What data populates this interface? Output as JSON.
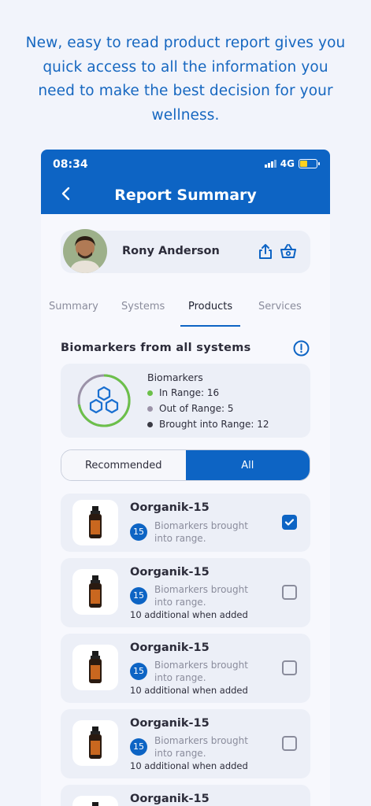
{
  "tagline": "New, easy to read product report gives you quick access to all the information you need to make the best decision for your wellness.",
  "status_bar": {
    "time": "08:34",
    "network": "4G"
  },
  "header": {
    "title": "Report Summary"
  },
  "user": {
    "name": "Rony Anderson"
  },
  "tabs": [
    {
      "label": "Summary",
      "active": false
    },
    {
      "label": "Systems",
      "active": false
    },
    {
      "label": "Products",
      "active": true
    },
    {
      "label": "Services",
      "active": false
    }
  ],
  "biomarkers": {
    "section_title": "Biomarkers from all systems",
    "card_title": "Biomarkers",
    "legend": [
      {
        "label": "In Range: 16",
        "value": 16,
        "color": "#6cc04a"
      },
      {
        "label": "Out of Range: 5",
        "value": 5,
        "color": "#9b92a8"
      },
      {
        "label": "Brought into Range: 12",
        "value": 12,
        "color": "#3a3a44"
      }
    ]
  },
  "filter": {
    "left_label": "Recommended",
    "right_label": "All",
    "selected": "All"
  },
  "products": [
    {
      "name": "Oorganik-15",
      "count": "15",
      "desc": "Biomarkers brought into range.",
      "extra": "",
      "checked": true
    },
    {
      "name": "Oorganik-15",
      "count": "15",
      "desc": "Biomarkers brought into range.",
      "extra": "10 additional when added",
      "checked": false
    },
    {
      "name": "Oorganik-15",
      "count": "15",
      "desc": "Biomarkers brought into range.",
      "extra": "10 additional when added",
      "checked": false
    },
    {
      "name": "Oorganik-15",
      "count": "15",
      "desc": "Biomarkers brought into range.",
      "extra": "10 additional when added",
      "checked": false
    },
    {
      "name": "Oorganik-15",
      "count": "",
      "desc": "",
      "extra": "",
      "checked": false
    }
  ],
  "colors": {
    "brand": "#0d64c4",
    "background": "#f2f4fb"
  }
}
